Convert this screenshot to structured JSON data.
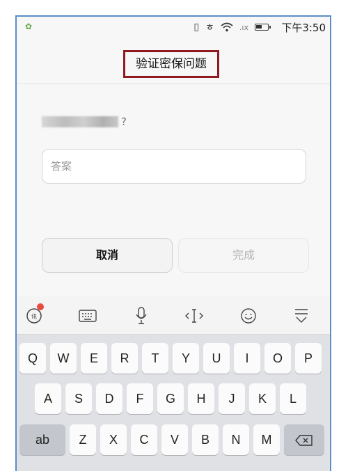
{
  "status_bar": {
    "time": "下午3:50",
    "icons": [
      "app-notification-icon",
      "vibrate-icon",
      "eye-icon",
      "wifi-icon",
      "no-signal-icon",
      "battery-icon"
    ]
  },
  "header": {
    "title": "验证密保问题"
  },
  "question": {
    "suffix": "?"
  },
  "answer": {
    "placeholder": "答案",
    "value": ""
  },
  "buttons": {
    "cancel": "取消",
    "done": "完成"
  },
  "keyboard": {
    "toolbar": [
      "ime-logo-icon",
      "keyboard-icon",
      "microphone-icon",
      "cursor-icon",
      "emoji-icon",
      "collapse-icon"
    ],
    "row1": [
      "Q",
      "W",
      "E",
      "R",
      "T",
      "Y",
      "U",
      "I",
      "O",
      "P"
    ],
    "row2": [
      "A",
      "S",
      "D",
      "F",
      "G",
      "H",
      "J",
      "K",
      "L"
    ],
    "row3_left": "ab",
    "row3": [
      "Z",
      "X",
      "C",
      "V",
      "B",
      "N",
      "M"
    ],
    "backspace": "⌫"
  }
}
